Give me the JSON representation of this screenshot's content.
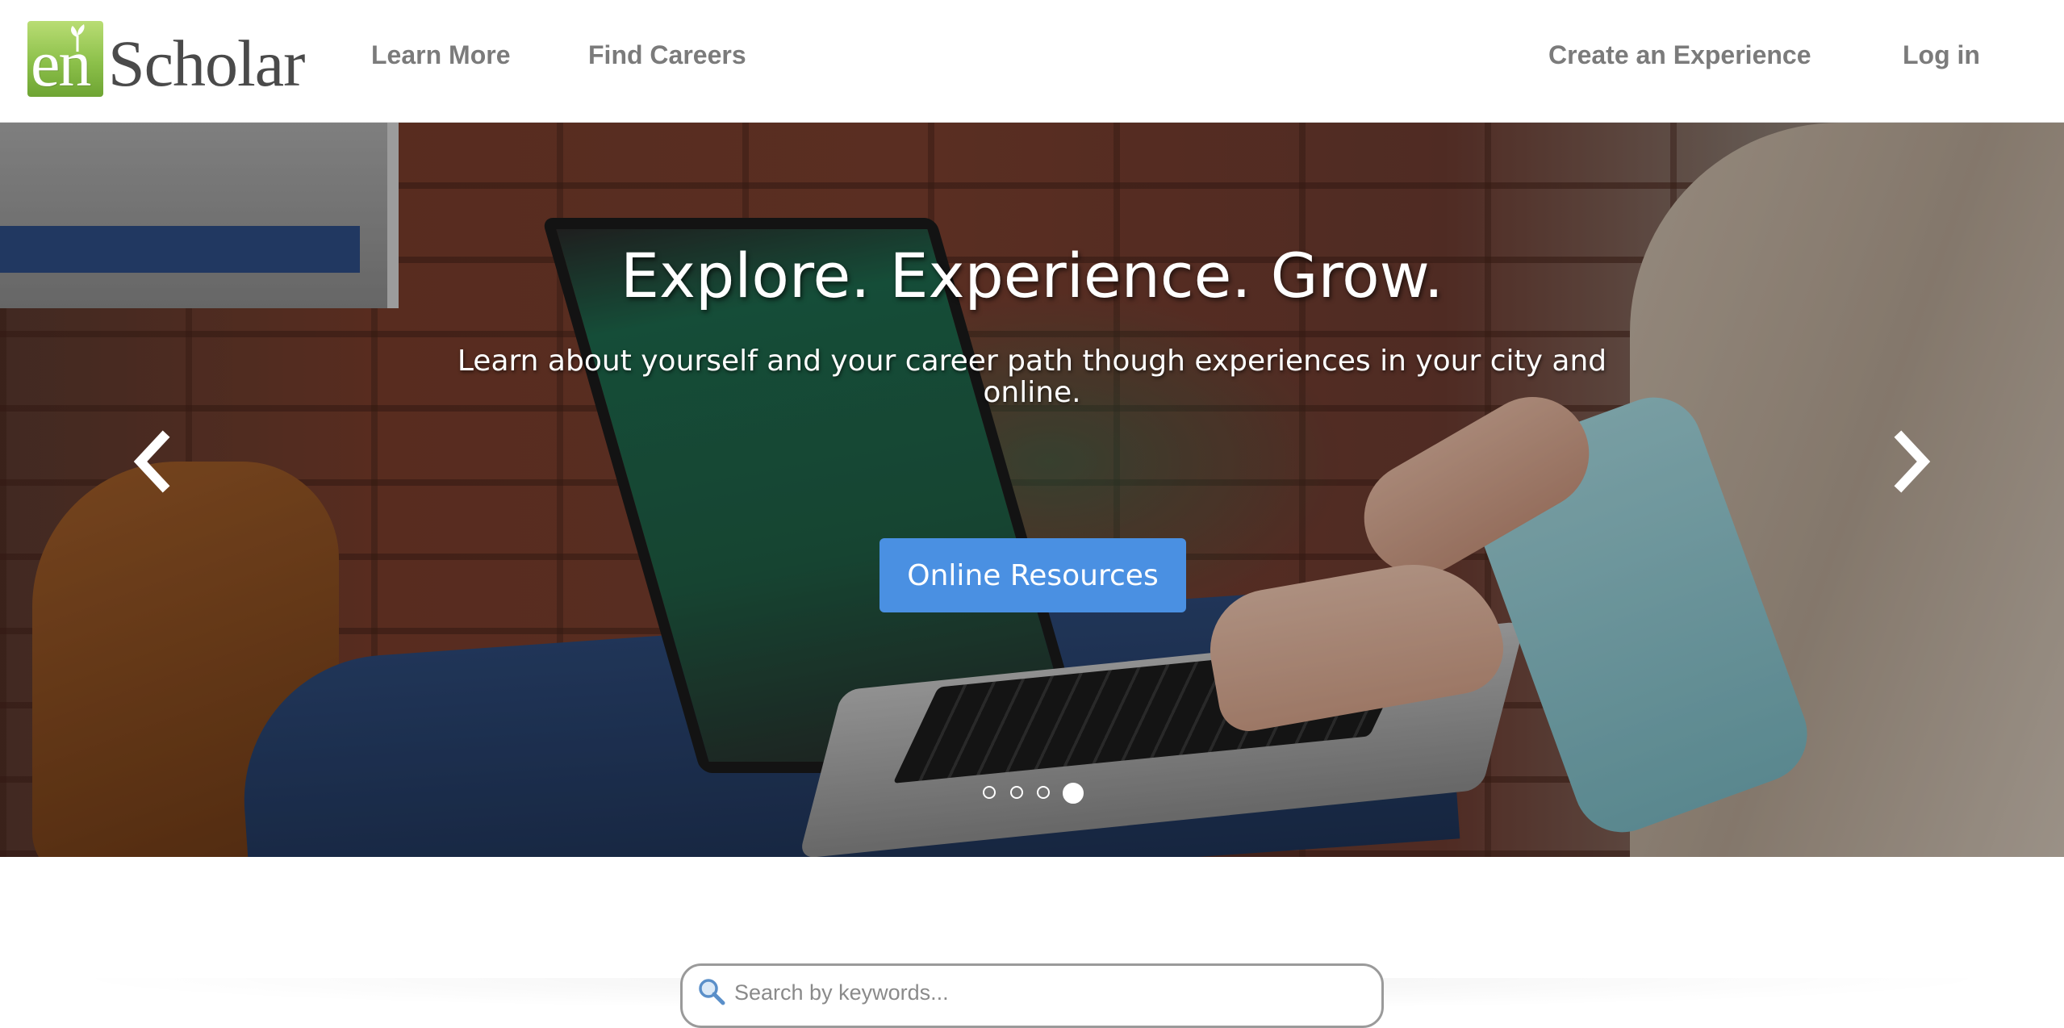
{
  "header": {
    "logo": {
      "prefix": "en",
      "name": "Scholar"
    },
    "nav_left": [
      "Learn More",
      "Find Careers"
    ],
    "nav_right": [
      "Create an Experience",
      "Log in"
    ]
  },
  "hero": {
    "title": "Explore. Experience. Grow.",
    "subtitle": "Learn about yourself and your career path though experiences in your city and online.",
    "cta_label": "Online Resources",
    "slide_count": 4,
    "active_slide": 4,
    "prev_icon": "chevron-left-icon",
    "next_icon": "chevron-right-icon"
  },
  "search": {
    "placeholder": "Search by keywords...",
    "icon": "search-icon"
  },
  "colors": {
    "nav_text": "#7b7b7b",
    "cta": "#4a90e2",
    "logo_green": "#8cc04a"
  }
}
